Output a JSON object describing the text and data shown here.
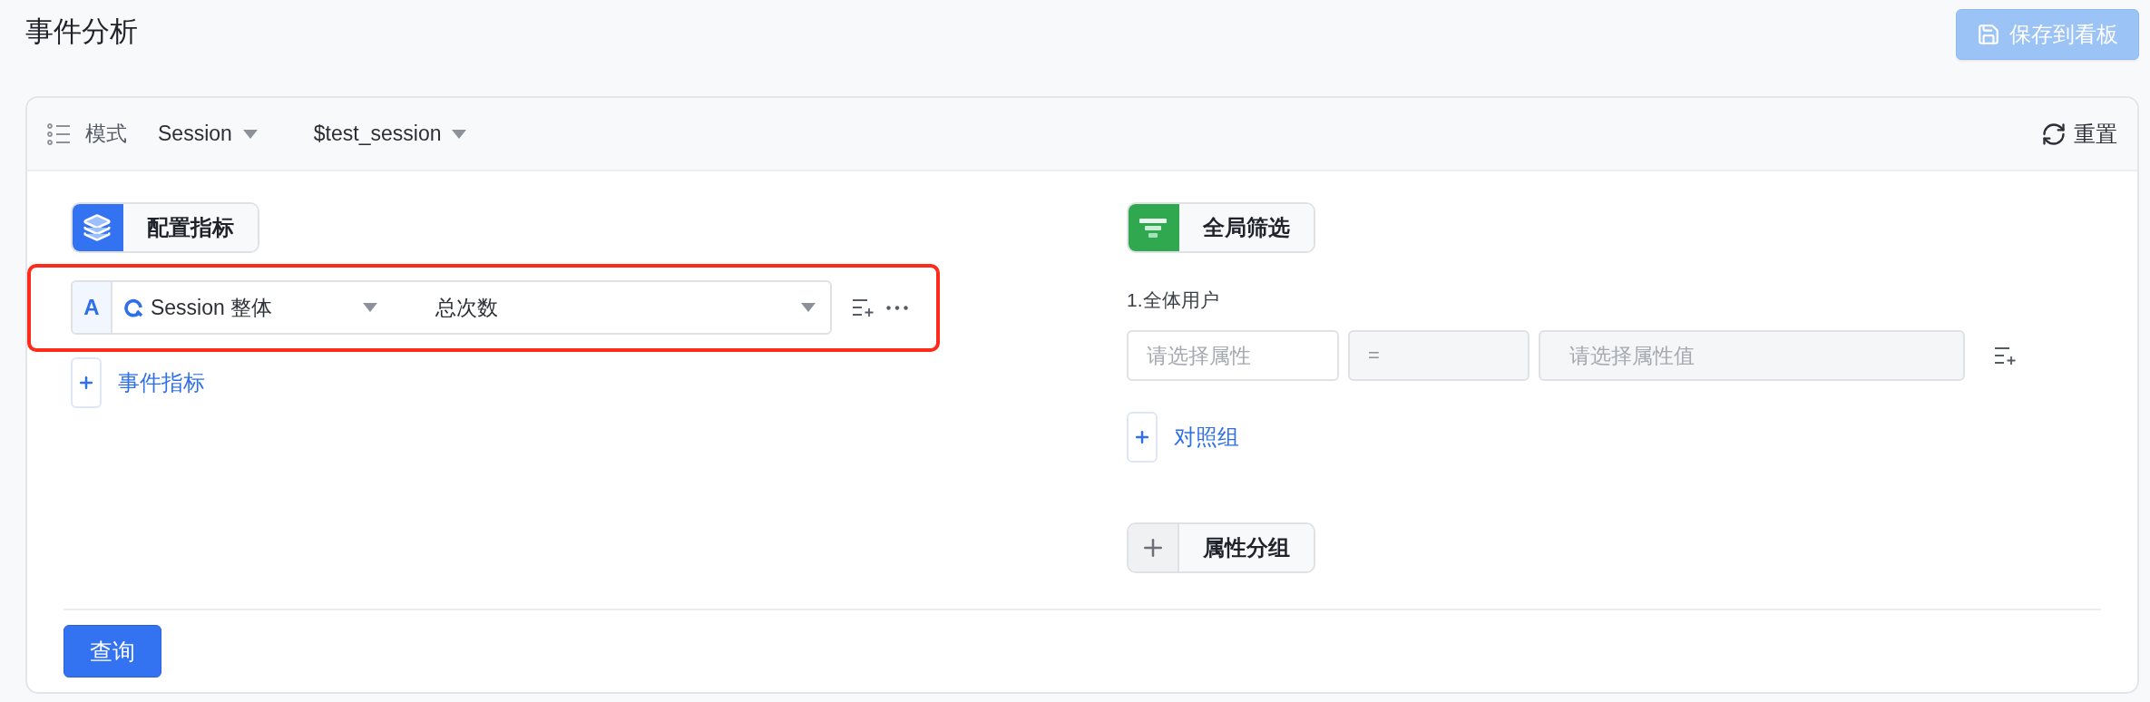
{
  "page": {
    "title": "事件分析"
  },
  "save_button": {
    "label": "保存到看板",
    "disabled": true
  },
  "toolbar": {
    "mode_label": "模式",
    "dropdowns": [
      {
        "value": "Session"
      },
      {
        "value": "$test_session"
      }
    ],
    "reset": "重置"
  },
  "metrics": {
    "header": "配置指标",
    "rows": [
      {
        "letter": "A",
        "event": "Session 整体",
        "aggregation": "总次数",
        "highlighted": true
      }
    ],
    "add": "事件指标"
  },
  "filters": {
    "header": "全局筛选",
    "group_label": "1.全体用户",
    "conditions": [
      {
        "property_placeholder": "请选择属性",
        "operator": "=",
        "value_placeholder": "请选择属性值"
      }
    ],
    "add": "对照组"
  },
  "grouping": {
    "header": "属性分组"
  },
  "query_button": "查询"
}
